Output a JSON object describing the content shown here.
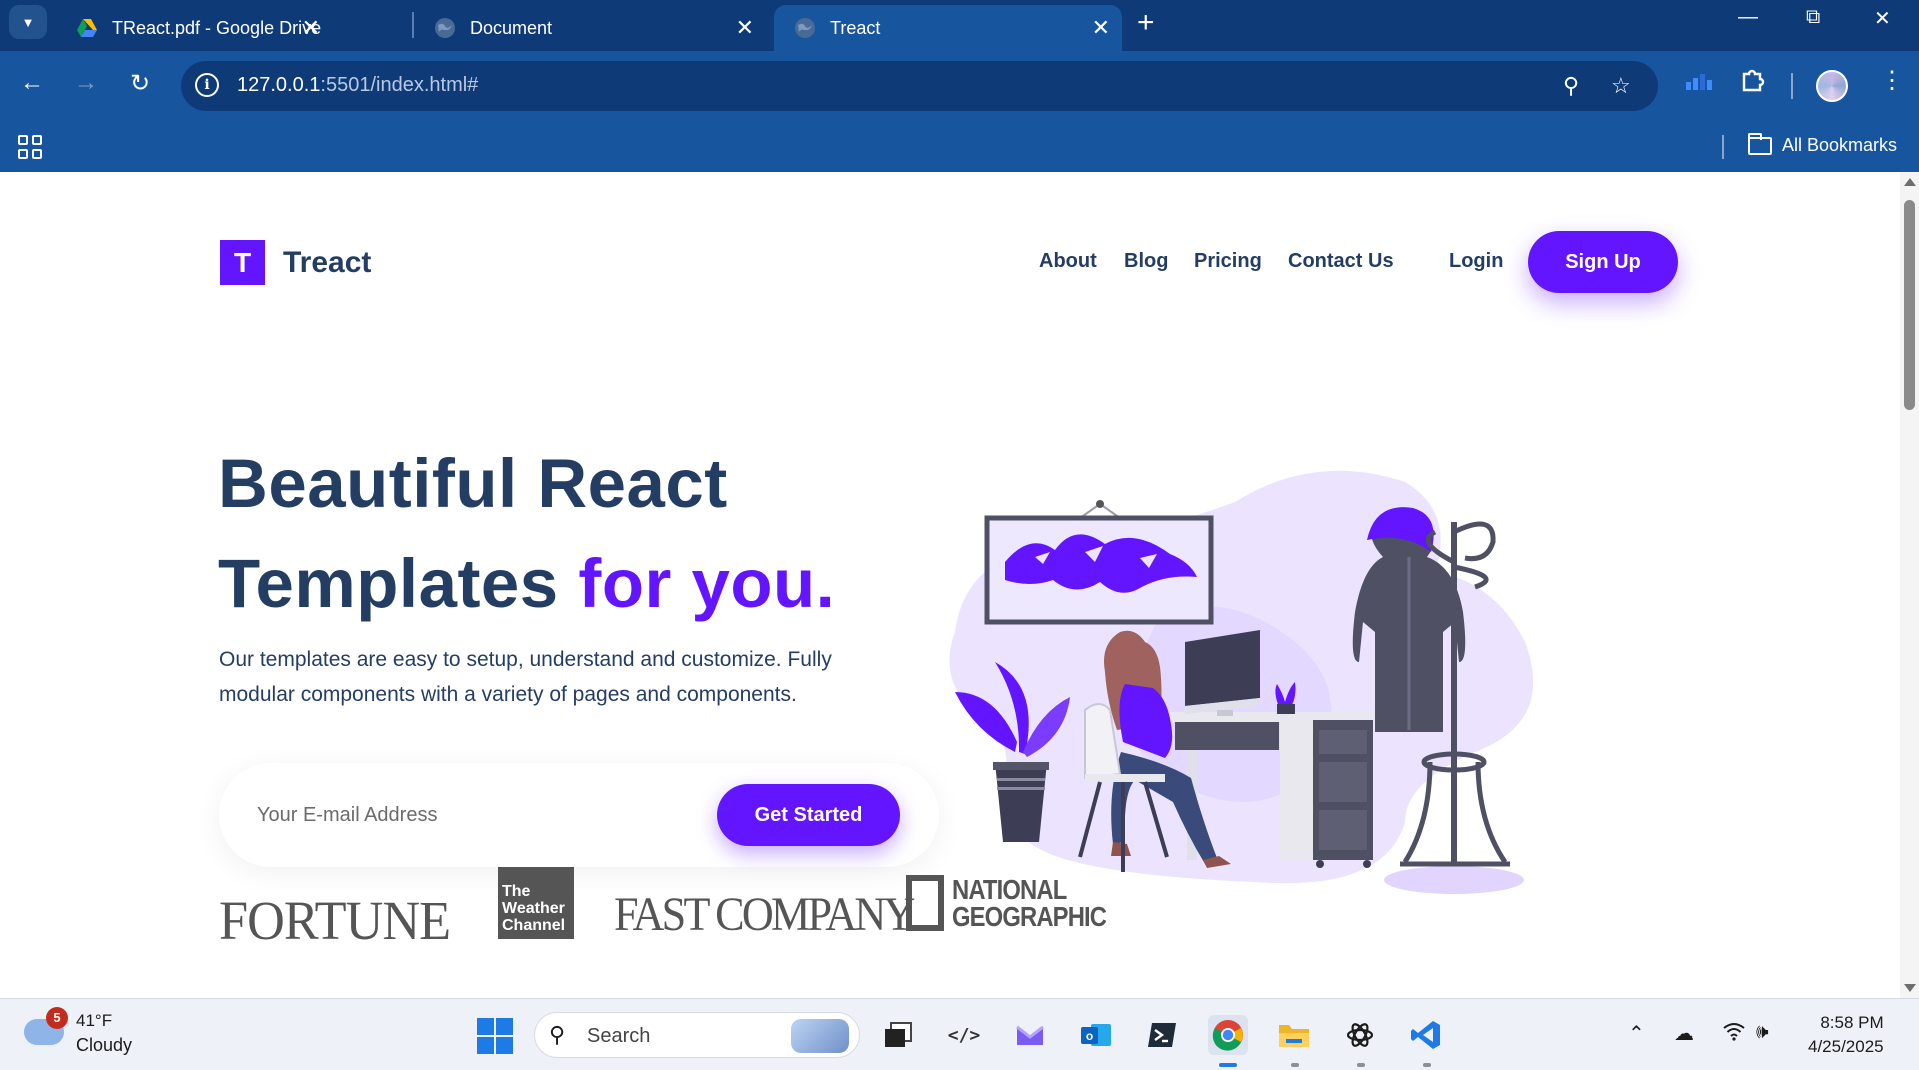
{
  "browser": {
    "tabs": [
      {
        "title": "TReact.pdf - Google Drive",
        "icon": "google-drive-icon",
        "active": false
      },
      {
        "title": "Document",
        "icon": "globe-icon",
        "active": false
      },
      {
        "title": "Treact",
        "icon": "globe-icon",
        "active": true
      }
    ],
    "url_host": "127.0.0.1",
    "url_rest": ":5501/index.html#",
    "bookmarks_label": "All Bookmarks"
  },
  "site": {
    "brand_letter": "T",
    "brand_name": "Treact",
    "nav": [
      "About",
      "Blog",
      "Pricing",
      "Contact Us"
    ],
    "login_label": "Login",
    "signup_label": "Sign Up",
    "hero": {
      "title_line1": "Beautiful React",
      "title_line2_plain": "Templates ",
      "title_line2_accent": "for you.",
      "description_line1": "Our templates are easy to setup, understand and customize. Fully",
      "description_line2": "modular components with a variety of pages and components.",
      "email_placeholder": "Your E-mail Address",
      "cta_label": "Get Started"
    },
    "customer_logos": {
      "fortune": "FORTUNE",
      "weather_channel": [
        "The",
        "Weather",
        "Channel"
      ],
      "fast_company": "FAST COMPANY",
      "natgeo": [
        "NATIONAL",
        "GEOGRAPHIC"
      ]
    },
    "colors": {
      "primary": "#6415ff",
      "heading": "#243e63"
    }
  },
  "taskbar": {
    "weather_temp": "41°F",
    "weather_condition": "Cloudy",
    "weather_badge": "5",
    "search_placeholder": "Search",
    "time": "8:58 PM",
    "date": "4/25/2025"
  }
}
